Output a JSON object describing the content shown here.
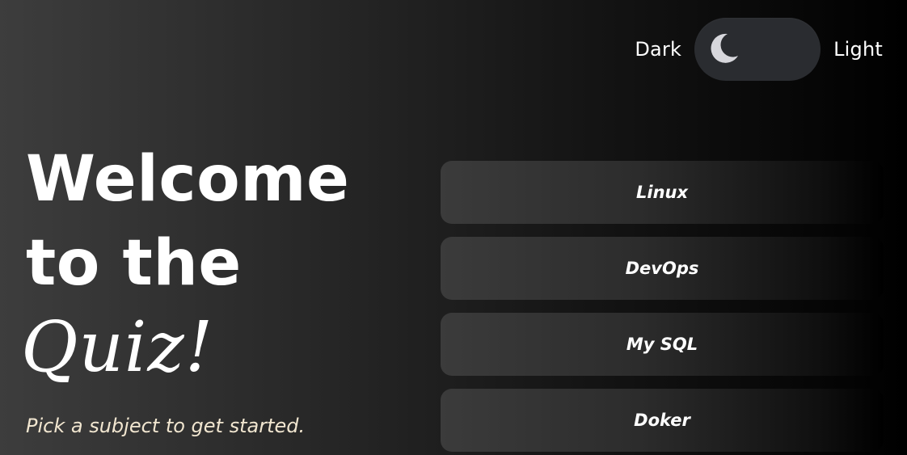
{
  "theme_toggle": {
    "dark_label": "Dark",
    "light_label": "Light",
    "current": "dark",
    "knob_icon": "moon-icon",
    "knob_color": "#d7d7dc",
    "track_color": "#2a2c30"
  },
  "hero": {
    "line1": "Welcome",
    "line2": "to the",
    "line3": "Quiz!",
    "subtitle": "Pick a subject to get started."
  },
  "subjects": [
    {
      "label": "Linux"
    },
    {
      "label": "DevOps"
    },
    {
      "label": "My SQL"
    },
    {
      "label": "Doker"
    }
  ],
  "colors": {
    "text": "#ffffff",
    "subtitle": "#f1e6d0"
  }
}
